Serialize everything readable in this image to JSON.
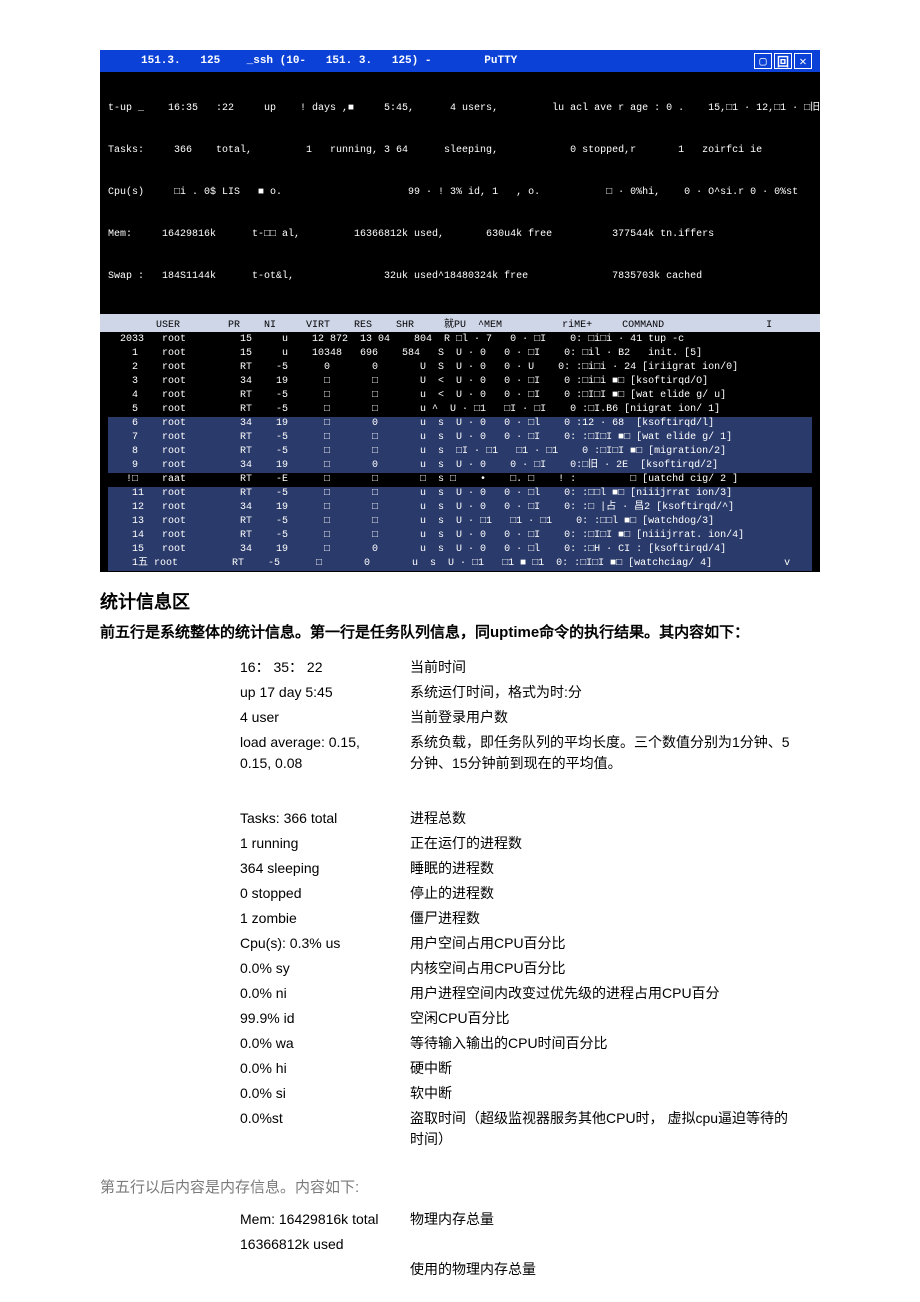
{
  "putty": {
    "title": "     151.3.   125    _ssh (10-   151. 3.   125) -        PuTTY",
    "top_lines": [
      "t-up _    16:35   :22     up    ! days ,■     5:45,      4 users,         lu acl ave r age : 0 .    15,□1 · 12,□1 · □旧",
      "Tasks:     366    total,         1   running, 3 64      sleeping,            0 stopped,r       1   zoirfci ie",
      "Cpu(s)     □i . 0$ LIS   ■ o.                     99 · ! 3% id, 1   , o.           □ · 0%hi,    0 · O^si.r 0 · 0%st",
      "Mem:     16429816k      t-□□ al,         16366812k used,       630u4k free          377544k tn.iffers",
      "Swap :   184S1144k      t-ot&l,               32uk used^18480324k free              7835703k cached"
    ],
    "header": "        USER        PR    NI     VIRT    RES    SHR     就PU  ^MEM          riME+     COMMAND                 I",
    "rows": [
      "  2033   root         15     u    12 872  13 04    804  R □l · 7   0 · □I    0: □i□i · 41 tup -c",
      "    1    root         15     u    10348   696    584   S  U · 0   0 · □I    0: □il · B2   init. [5]",
      "    2    root         RT    -5      0       0       U  S  U · 0   0 · U    0: :□i□i · 24 [iriigrat ion/0]",
      "    3    root         34    19      □       □       U  <  U · 0   0 · □I    0 :□i□i ■□ [ksoftirqd/O]",
      "    4    root         RT    -5      □       □       u  <  U · 0   0 · □I    0 :□I□I ■□ [wat elide g/ u]",
      "    5    root         RT    -5      □       □       u ^  U · □1   □I · □I    0 :□I.B6 [niigrat ion/ 1]",
      "    6    root         34    19      □       0       u  s  U · 0   0 · □l    0 :12 · 68  [ksoftirqd/l]",
      "    7    root         RT    -5      □       □       u  s  U · 0   0 · □I    0: :□I□I ■□ [wat elide g/ 1]",
      "    8    root         RT    -5      □       □       u  s  □I · □1   □1 · □1    0 :□I□I ■□ [migration/2]",
      "    9    root         34    19      □       0       u  s  U · 0    0 · □I    0:□旧 · 2E  [ksoftirqd/2]",
      "   !□    raat         RT    -E      □       □       □  s □    •    □. □    ! :         □ [uatchd cig/ 2 ]",
      "    11   root         RT    -5      □       □       u  s  U · 0   0 · □l    0: :□□l ■□ [niiijrrat ion/3]",
      "    12   root         34    19      □       □       u  s  U · 0   0 · □I    0: :□ |占 · 昌2 [ksoftirqd/^]",
      "    13   root         RT    -5      □       □       u  s  U · □1   □1 · □1    0: :□□l ■□ [watchdog/3]",
      "    14   root         RT    -5      □       □       u  s  U · 0   0 · □I    0: :□I□I ■□ [niiijrrat. ion/4]",
      "    15   root         34    19      □       0       u  s  U · 0   0 · □l    0: :□H · CI : [ksoftirqd/4]",
      "    1五 root         RT    -5      □       0       u  s  U · □1   □1 ■ □1  0: :□I□I ■□ [watchciag/ 4]            v"
    ]
  },
  "heading_stats": "统计信息区",
  "lead_para": "前五行是系统整体的统计信息。第一行是任务队列信息，同uptime命令的执行结果。其内容如下：",
  "table1": [
    {
      "k": "16： 35： 22",
      "v": "当前时间"
    },
    {
      "k": "  up 17 day 5:45",
      "v": "系统运仃时间，格式为时:分"
    },
    {
      "k": "4 user",
      "v": "当前登录用户数"
    },
    {
      "k": "load average: 0.15, 0.15, 0.08",
      "v": "系统负载，即任务队列的平均长度。三个数值分别为1分钟、5分钟、15分钟前到现在的平均值。"
    }
  ],
  "table2": [
    {
      "k": "Tasks: 366 total",
      "v": "进程总数"
    },
    {
      "k": "1 running",
      "v": "正在运仃的进程数"
    },
    {
      "k": "364 sleeping",
      "v": "睡眠的进程数"
    },
    {
      "k": "0 stopped",
      "v": "停止的进程数"
    },
    {
      "k": "1 zombie",
      "v": "僵尸进程数"
    },
    {
      "k": "Cpu(s): 0.3% us",
      "v": "用户空间占用CPU百分比"
    },
    {
      "k": "0.0% sy",
      "v": "内核空间占用CPU百分比"
    },
    {
      "k": "0.0% ni",
      "v": "用户进程空间内改变过优先级的进程占用CPU百分"
    },
    {
      "k": "99.9% id",
      "v": "空闲CPU百分比"
    },
    {
      "k": "0.0% wa",
      "v": "等待输入输出的CPU时间百分比"
    },
    {
      "k": "0.0% hi",
      "v": "硬中断"
    },
    {
      "k": "0.0% si",
      "v": "软中断"
    },
    {
      "k": "0.0%st",
      "v": "盗取时间（超级监视器服务其他CPU时，  虚拟cpu逼迫等待的时间）"
    }
  ],
  "gray_line": "第五行以后内容是内存信息。内容如下:",
  "table3": [
    {
      "k": "Mem: 16429816k total",
      "v": "物理内存总量"
    },
    {
      "k": "16366812k used",
      "v": ""
    },
    {
      "k": "",
      "v": "使用的物理内存总量"
    }
  ]
}
